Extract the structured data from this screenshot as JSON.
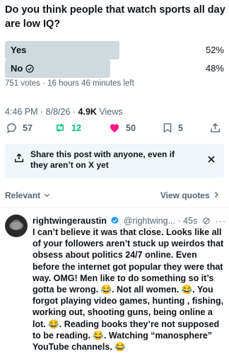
{
  "poll": {
    "question": "Do you think people that watch sports all day are low IQ?",
    "options": [
      {
        "label": "Yes",
        "percent": "52%",
        "fraction": 0.52,
        "winner": false
      },
      {
        "label": "No",
        "percent": "48%",
        "fraction": 0.48,
        "winner": true
      }
    ],
    "meta": "751 votes · 16 hours 46 minutes left"
  },
  "post": {
    "time": "4:46 PM · 8/8/26 · ",
    "views_count": "4.9K",
    "views_label": " Views"
  },
  "actions": {
    "replies": "57",
    "reposts": "12",
    "likes": "50",
    "bookmarks": "5"
  },
  "share_card": {
    "text": "Share this post with anyone, even if they aren’t on X yet"
  },
  "replies_header": {
    "sort_label": "Relevant",
    "view_quotes": "View quotes"
  },
  "reply": {
    "name": "rightwingeraustin",
    "handle": "@rightwing...",
    "time": "· 45s",
    "text": "I can’t believe it was that close.  Looks like all of your followers aren’t stuck up weirdos that obsess about politics 24/7 online.  Even before the internet got popular they were that way.  OMG! Men like to do something so it’s gotta be wrong. 😂.  Not all women. 😂.  You forgot playing video games,  hunting , fishing, working out, shooting guns,  being online a lot. 😂.  Reading books they’re not supposed to be reading. 😂.  Watching “manosphere” YouTube channels. 😂"
  },
  "colors": {
    "text": "#0f1419",
    "secondary": "#536471",
    "poll_bar": "#cfd9de",
    "like_pink": "#f91880",
    "repost_green": "#00ba7c",
    "verified_blue": "#1d9bf0",
    "share_bg": "#f0f6fb"
  }
}
